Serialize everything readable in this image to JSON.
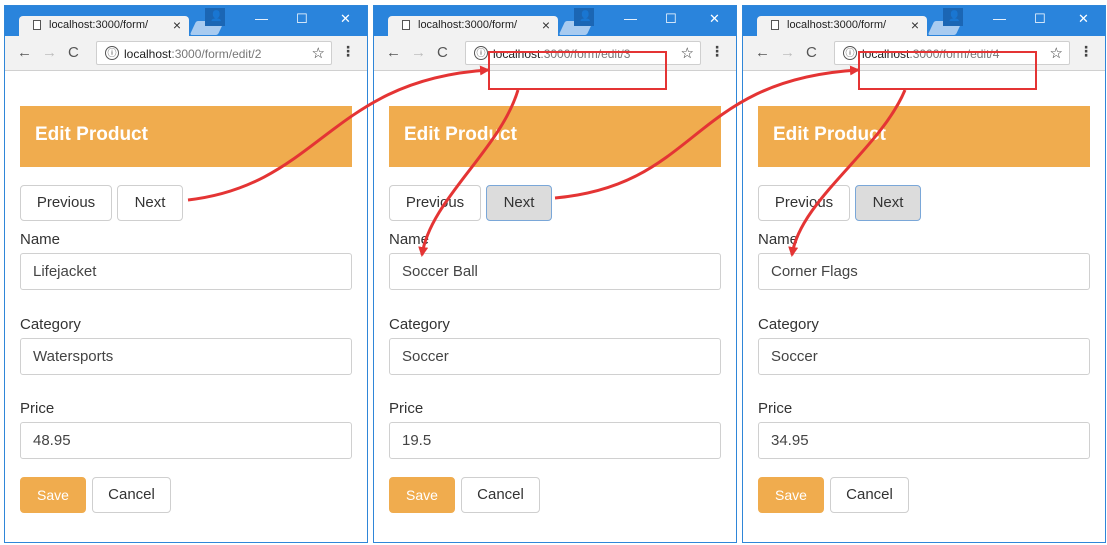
{
  "browser": {
    "tab_title": "localhost:3000/form/",
    "url_host": "localhost",
    "info_icon": "ⓘ"
  },
  "page": {
    "header": "Edit Product",
    "previous_label": "Previous",
    "next_label": "Next",
    "name_label": "Name",
    "category_label": "Category",
    "price_label": "Price",
    "save_label": "Save",
    "cancel_label": "Cancel"
  },
  "windows": [
    {
      "url_path": ":3000/form/edit/2",
      "name": "Lifejacket",
      "category": "Watersports",
      "price": "48.95",
      "next_active": false
    },
    {
      "url_path": ":3000/form/edit/3",
      "name": "Soccer Ball",
      "category": "Soccer",
      "price": "19.5",
      "next_active": true
    },
    {
      "url_path": ":3000/form/edit/4",
      "name": "Corner Flags",
      "category": "Soccer",
      "price": "34.95",
      "next_active": true
    }
  ],
  "colors": {
    "accent": "#f0ac4e",
    "titlebar": "#2a84dc",
    "annotation": "#e43434"
  }
}
